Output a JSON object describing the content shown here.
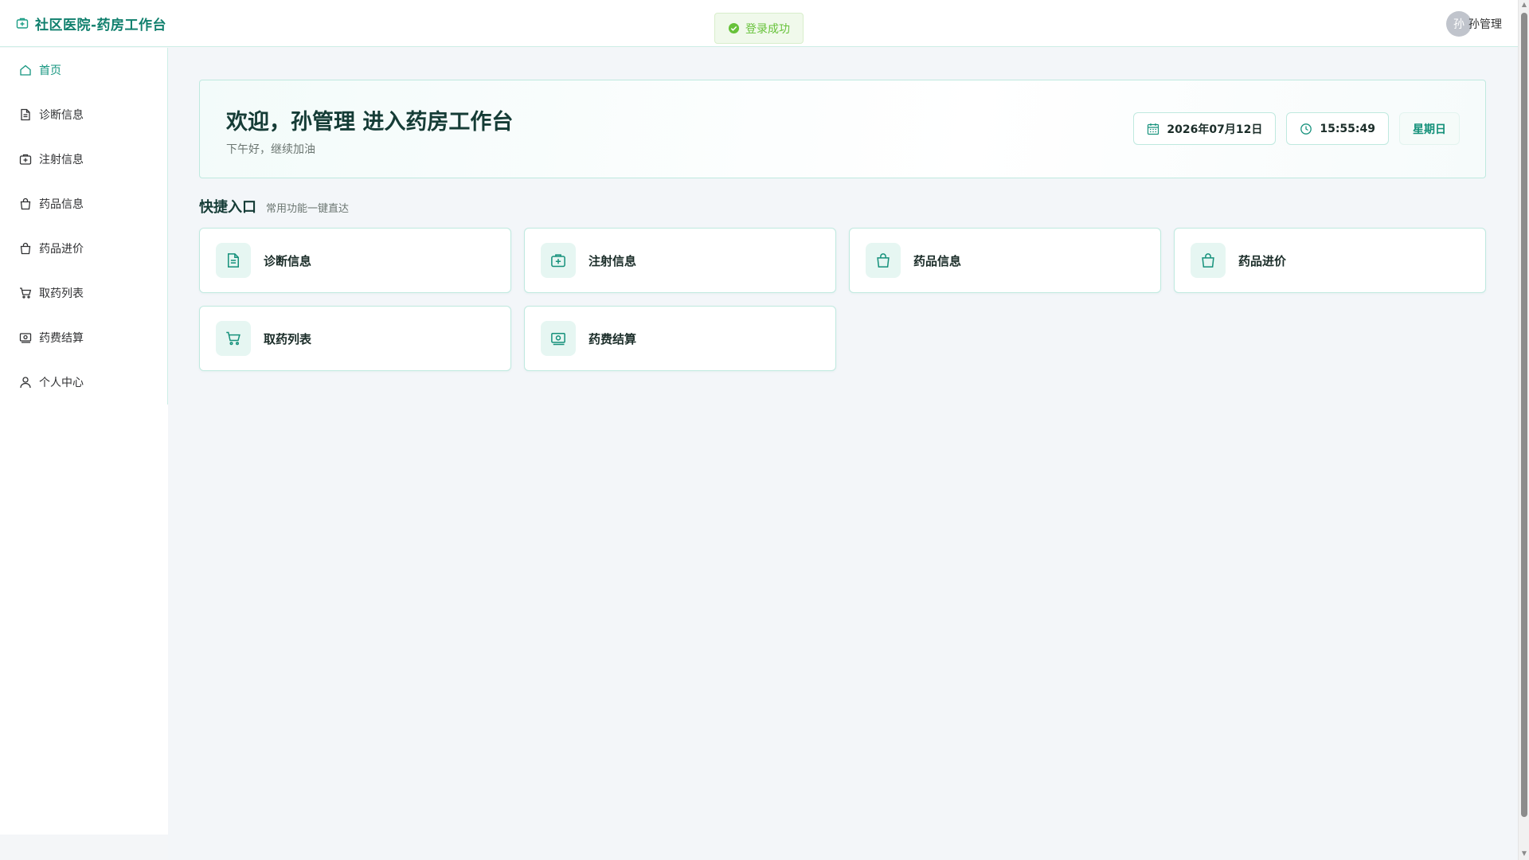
{
  "header": {
    "title": "社区医院-药房工作台",
    "toast": "登录成功",
    "avatar_initial": "孙",
    "user_name": "孙管理"
  },
  "sidebar": {
    "items": [
      {
        "label": "首页",
        "icon": "home-icon",
        "active": true
      },
      {
        "label": "诊断信息",
        "icon": "document-icon"
      },
      {
        "label": "注射信息",
        "icon": "medical-kit-icon"
      },
      {
        "label": "药品信息",
        "icon": "shopping-bag-icon"
      },
      {
        "label": "药品进价",
        "icon": "shopping-bag-icon"
      },
      {
        "label": "取药列表",
        "icon": "cart-icon"
      },
      {
        "label": "药费结算",
        "icon": "money-icon"
      },
      {
        "label": "个人中心",
        "icon": "user-icon"
      }
    ]
  },
  "welcome": {
    "title": "欢迎，孙管理 进入药房工作台",
    "subtitle": "下午好，继续加油",
    "date": "2026年07月12日",
    "time": "15:55:49",
    "weekday": "星期日"
  },
  "quick": {
    "title": "快捷入口",
    "subtitle": "常用功能一键直达",
    "cards": [
      {
        "label": "诊断信息",
        "icon": "document-icon"
      },
      {
        "label": "注射信息",
        "icon": "medical-kit-icon"
      },
      {
        "label": "药品信息",
        "icon": "shopping-bag-icon"
      },
      {
        "label": "药品进价",
        "icon": "shopping-bag-icon"
      },
      {
        "label": "取药列表",
        "icon": "cart-icon"
      },
      {
        "label": "药费结算",
        "icon": "money-icon"
      }
    ]
  },
  "colors": {
    "accent": "#14957f",
    "success": "#67c23a",
    "border": "#bfe9df"
  }
}
